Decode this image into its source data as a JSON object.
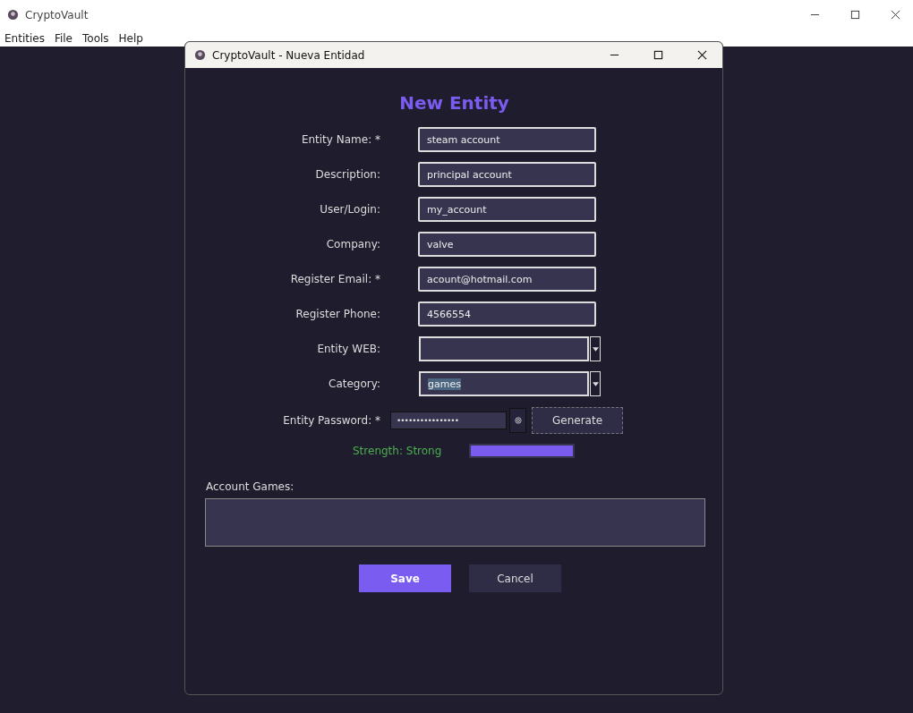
{
  "app_window": {
    "title": "CryptoVault",
    "menu": [
      "Entities",
      "File",
      "Tools",
      "Help"
    ]
  },
  "dialog": {
    "title": "CryptoVault - Nueva Entidad",
    "heading": "New Entity",
    "fields": [
      {
        "kind": "text",
        "label": "Entity Name: *",
        "value": "steam account",
        "text_selected": false
      },
      {
        "kind": "text",
        "label": "Description:",
        "value": "principal account",
        "text_selected": false
      },
      {
        "kind": "text",
        "label": "User/Login:",
        "value": "my_account",
        "text_selected": false
      },
      {
        "kind": "text",
        "label": "Company:",
        "value": "valve",
        "text_selected": false
      },
      {
        "kind": "text",
        "label": "Register Email: *",
        "value": "acount@hotmail.com",
        "text_selected": false
      },
      {
        "kind": "text",
        "label": "Register Phone:",
        "value": "4566554",
        "text_selected": false
      },
      {
        "kind": "combo",
        "label": "Entity WEB:"
      },
      {
        "kind": "combo",
        "label": "Category:",
        "value": "games",
        "text_selected": true
      }
    ],
    "password": {
      "label": "Entity Password: *",
      "value": "••••••••••••••••",
      "generate": "Generate"
    },
    "strength": {
      "label": "Strength: Strong",
      "level": 1
    },
    "notes": {
      "label": "Account Games:"
    },
    "buttons": [
      {
        "label": "Save",
        "primary": true
      },
      {
        "label": "Cancel",
        "primary": false
      }
    ]
  }
}
